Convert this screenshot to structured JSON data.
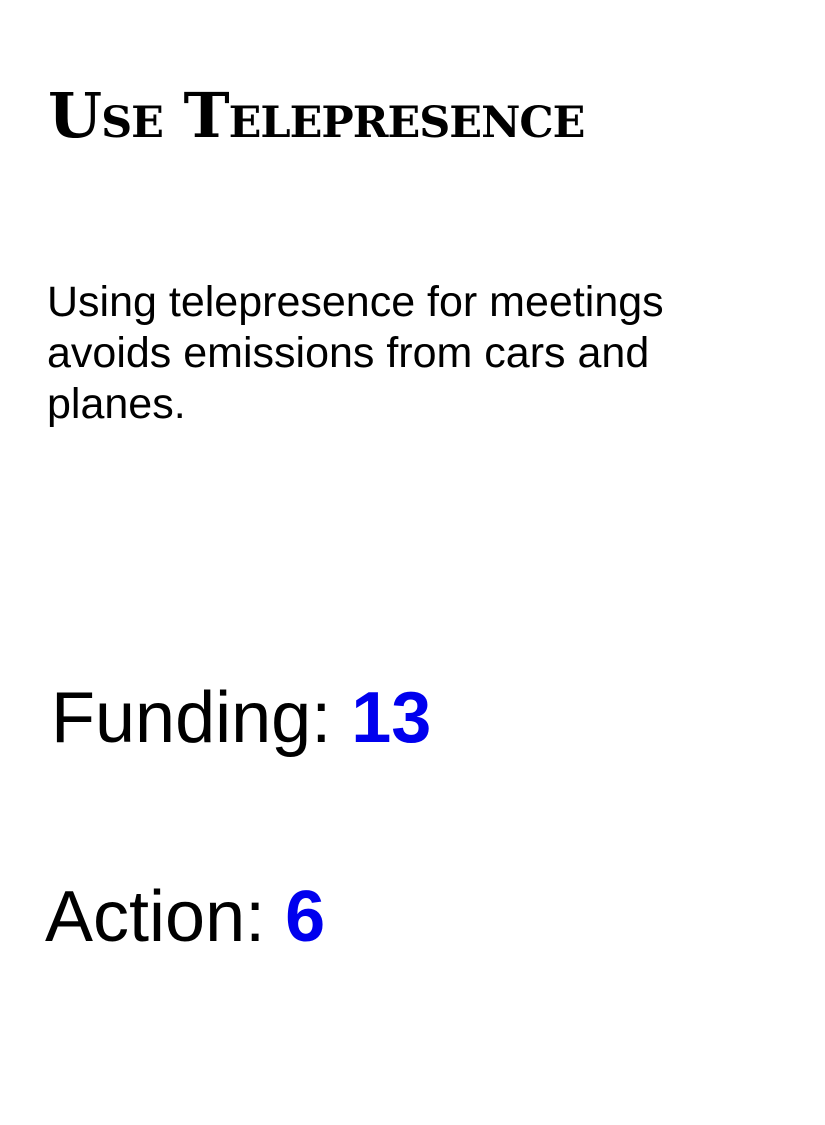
{
  "card": {
    "title": "Use Telepresence",
    "description": "Using telepresence for meetings avoids emissions from cars and planes.",
    "funding": {
      "label": "Funding:",
      "value": "13"
    },
    "action": {
      "label": "Action:",
      "value": "6"
    }
  },
  "colors": {
    "text": "#000000",
    "value": "#0000ee",
    "background": "#ffffff"
  }
}
